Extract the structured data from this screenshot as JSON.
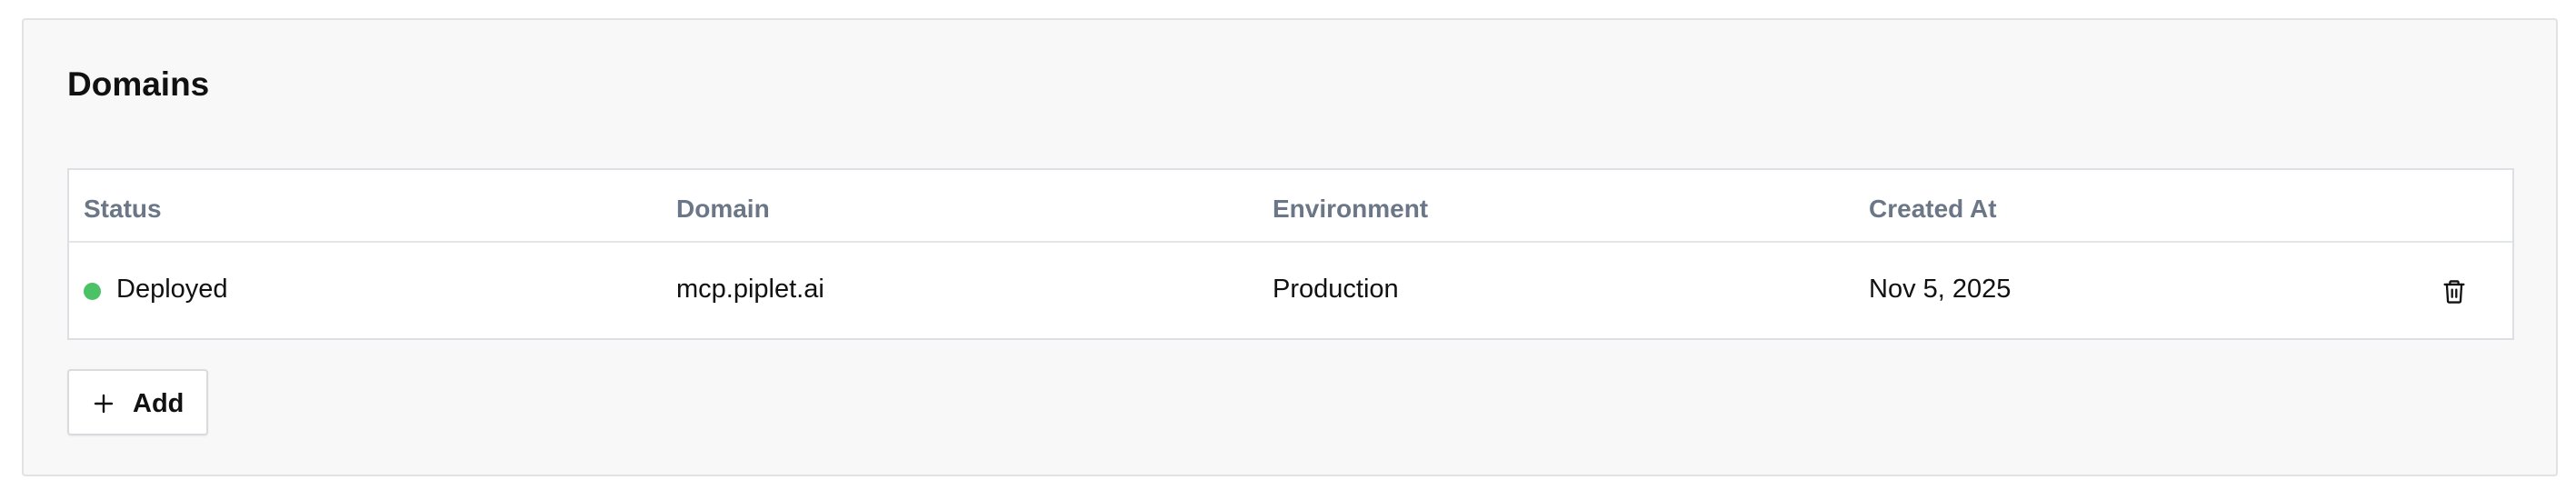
{
  "section": {
    "title": "Domains"
  },
  "table": {
    "columns": [
      "Status",
      "Domain",
      "Environment",
      "Created At"
    ],
    "rows": [
      {
        "status": "Deployed",
        "status_color": "#4cc267",
        "domain": "mcp.piplet.ai",
        "environment": "Production",
        "created_at": "Nov 5, 2025",
        "action_icon": "trash-icon"
      }
    ]
  },
  "actions": {
    "add_label": "Add",
    "add_icon": "plus-icon"
  }
}
